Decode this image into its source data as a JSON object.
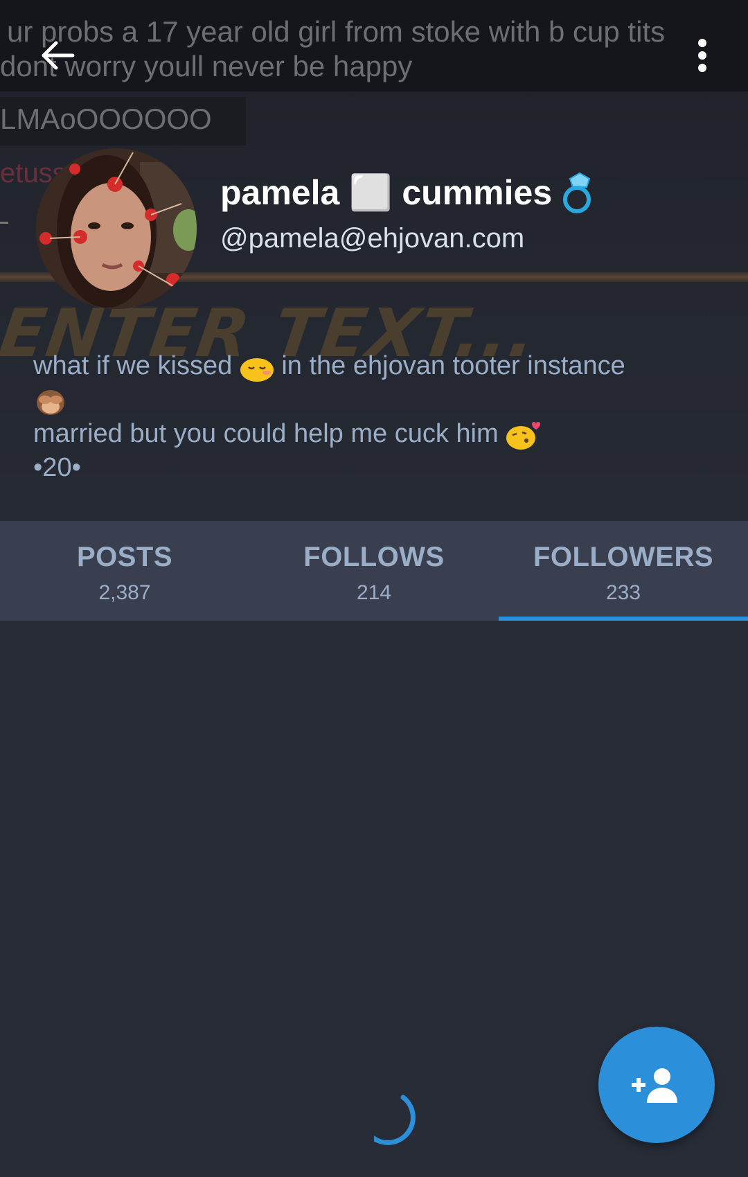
{
  "banner": {
    "line1": "ur probs a 17 year old girl from stoke with b cup tits",
    "line2": "dont worry youll never be happy",
    "line3": "LMAoOOOOOO",
    "line4": "etuss",
    "overlay": "ENTER TEXT..."
  },
  "topbar": {
    "back_icon": "arrow-left-icon",
    "menu_icon": "more-vertical-icon"
  },
  "profile": {
    "display_name": "pamela ⬜ cummies",
    "name_emoji": "ring-icon",
    "handle": "@pamela@ehjovan.com",
    "bio": {
      "line1_a": "what if we kissed",
      "line1_b": "in the ehjovan tooter instance",
      "line2_b": "married but you could help me cuck him",
      "line3": "•20•"
    }
  },
  "tabs": [
    {
      "label": "POSTS",
      "count": "2,387",
      "active": false
    },
    {
      "label": "FOLLOWS",
      "count": "214",
      "active": false
    },
    {
      "label": "FOLLOWERS",
      "count": "233",
      "active": true
    }
  ],
  "fab": {
    "icon": "add-person-icon"
  },
  "colors": {
    "background": "#282c37",
    "tab_bar": "#393f4f",
    "accent": "#2b90d9",
    "text_secondary": "#9baec8"
  }
}
